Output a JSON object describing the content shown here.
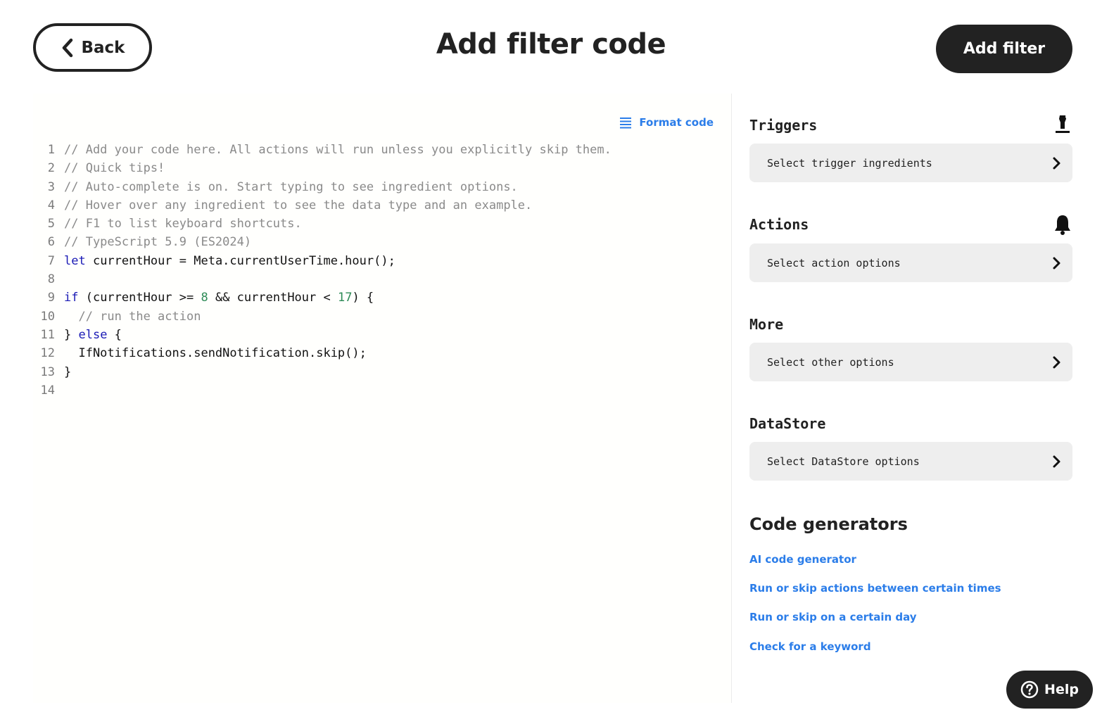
{
  "header": {
    "back_label": "Back",
    "title": "Add filter code",
    "add_filter_label": "Add filter"
  },
  "editor": {
    "format_code_label": "Format code",
    "lines": [
      {
        "num": "1",
        "tokens": [
          {
            "t": "// Add your code here. All actions will run unless you explicitly skip them.",
            "k": "c"
          }
        ]
      },
      {
        "num": "2",
        "tokens": [
          {
            "t": "// Quick tips!",
            "k": "c"
          }
        ]
      },
      {
        "num": "3",
        "tokens": [
          {
            "t": "// Auto-complete is on. Start typing to see ingredient options.",
            "k": "c"
          }
        ]
      },
      {
        "num": "4",
        "tokens": [
          {
            "t": "// Hover over any ingredient to see the data type and an example.",
            "k": "c"
          }
        ]
      },
      {
        "num": "5",
        "tokens": [
          {
            "t": "// F1 to list keyboard shortcuts.",
            "k": "c"
          }
        ]
      },
      {
        "num": "6",
        "tokens": [
          {
            "t": "// TypeScript 5.9 (ES2024)",
            "k": "c"
          }
        ]
      },
      {
        "num": "7",
        "tokens": [
          {
            "t": "let",
            "k": "k"
          },
          {
            "t": " currentHour = Meta.currentUserTime.hour();",
            "k": ""
          }
        ]
      },
      {
        "num": "8",
        "tokens": []
      },
      {
        "num": "9",
        "tokens": [
          {
            "t": "if",
            "k": "k"
          },
          {
            "t": " (currentHour >= ",
            "k": ""
          },
          {
            "t": "8",
            "k": "n"
          },
          {
            "t": " && currentHour < ",
            "k": ""
          },
          {
            "t": "17",
            "k": "n"
          },
          {
            "t": ") {",
            "k": ""
          }
        ]
      },
      {
        "num": "10",
        "tokens": [
          {
            "t": "  // run the action",
            "k": "c"
          }
        ]
      },
      {
        "num": "11",
        "tokens": [
          {
            "t": "} ",
            "k": ""
          },
          {
            "t": "else",
            "k": "k"
          },
          {
            "t": " {",
            "k": ""
          }
        ]
      },
      {
        "num": "12",
        "tokens": [
          {
            "t": "  IfNotifications.sendNotification.skip();",
            "k": ""
          }
        ]
      },
      {
        "num": "13",
        "tokens": [
          {
            "t": "}",
            "k": ""
          }
        ]
      },
      {
        "num": "14",
        "tokens": []
      }
    ]
  },
  "sidebar": {
    "sections": [
      {
        "title": "Triggers",
        "select_label": "Select trigger ingredients",
        "icon": "trigger-icon"
      },
      {
        "title": "Actions",
        "select_label": "Select action options",
        "icon": "bell-icon"
      },
      {
        "title": "More",
        "select_label": "Select other options",
        "icon": ""
      },
      {
        "title": "DataStore",
        "select_label": "Select DataStore options",
        "icon": ""
      }
    ],
    "generators_title": "Code generators",
    "generators": [
      "AI code generator",
      "Run or skip actions between certain times",
      "Run or skip on a certain day",
      "Check for a keyword"
    ]
  },
  "help_label": "Help",
  "colors": {
    "accent": "#2b7de9",
    "dark": "#222222",
    "keyword": "#1a1ab5",
    "number": "#2e8b57",
    "comment": "#8a8a8a"
  }
}
